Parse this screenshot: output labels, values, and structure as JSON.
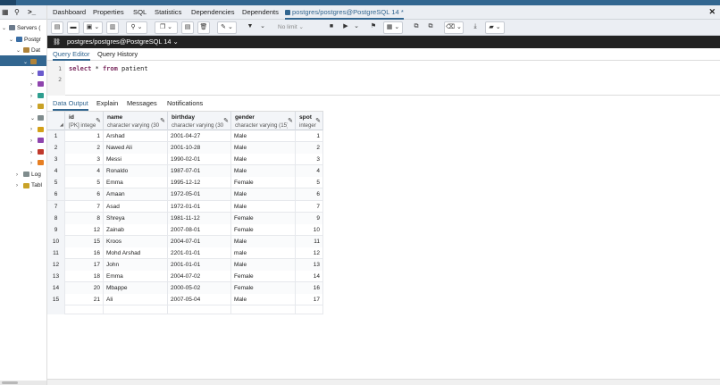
{
  "tree": {
    "header_icons": [
      "grid-icon",
      "search-icon",
      "terminal-icon"
    ],
    "nodes": [
      {
        "label": "Servers (",
        "caret": "v",
        "level": 0
      },
      {
        "label": "Postgr",
        "caret": "v",
        "level": 1
      },
      {
        "label": "Dat",
        "caret": "v",
        "level": 2
      },
      {
        "label": "",
        "caret": "v",
        "level": 3
      },
      {
        "label": "",
        "caret": "v",
        "level": 4
      },
      {
        "label": "",
        "caret": ">",
        "level": 4
      },
      {
        "label": "",
        "caret": ">",
        "level": 4
      },
      {
        "label": "",
        "caret": ">",
        "level": 4
      },
      {
        "label": "",
        "caret": "v",
        "level": 4
      },
      {
        "label": "",
        "caret": ">",
        "level": 4
      },
      {
        "label": "",
        "caret": ">",
        "level": 4
      },
      {
        "label": "",
        "caret": ">",
        "level": 4
      },
      {
        "label": "",
        "caret": ">",
        "level": 4
      },
      {
        "label": "Log",
        "caret": ">",
        "level": 2
      },
      {
        "label": "Tabl",
        "caret": ">",
        "level": 2
      }
    ]
  },
  "tabs": [
    {
      "label": "Dashboard"
    },
    {
      "label": "Properties"
    },
    {
      "label": "SQL"
    },
    {
      "label": "Statistics"
    },
    {
      "label": "Dependencies"
    },
    {
      "label": "Dependents"
    },
    {
      "label": "postgres/postgres@PostgreSQL 14 *",
      "active": true
    }
  ],
  "close_label": "✕",
  "toolbar": {
    "limit_label": "No limit"
  },
  "connection": {
    "label": "postgres/postgres@PostgreSQL 14 ⌄"
  },
  "query_tabs": [
    {
      "label": "Query Editor",
      "active": true
    },
    {
      "label": "Query History"
    }
  ],
  "editor": {
    "lines": [
      {
        "n": "1",
        "keyword1": "select",
        "mid": " * ",
        "keyword2": "from",
        "rest": " patient"
      },
      {
        "n": "2"
      }
    ]
  },
  "result_tabs": [
    {
      "label": "Data Output",
      "active": true
    },
    {
      "label": "Explain"
    },
    {
      "label": "Messages"
    },
    {
      "label": "Notifications"
    }
  ],
  "grid": {
    "columns": [
      {
        "name": "id",
        "type": "[PK] integer"
      },
      {
        "name": "name",
        "type": "character varying (30)"
      },
      {
        "name": "birthday",
        "type": "character varying (30)"
      },
      {
        "name": "gender",
        "type": "character varying (15)"
      },
      {
        "name": "spot",
        "type": "integer"
      }
    ],
    "rows": [
      [
        "1",
        "1",
        "Arshad",
        "2001-04-27",
        "Male",
        "1"
      ],
      [
        "2",
        "2",
        "Nawed Ali",
        "2001-10-28",
        "Male",
        "2"
      ],
      [
        "3",
        "3",
        "Messi",
        "1990-02-01",
        "Male",
        "3"
      ],
      [
        "4",
        "4",
        "Ronaldo",
        "1987-07-01",
        "Male",
        "4"
      ],
      [
        "5",
        "5",
        "Emma",
        "1995-12-12",
        "Female",
        "5"
      ],
      [
        "6",
        "6",
        "Amaan",
        "1972-05-01",
        "Male",
        "6"
      ],
      [
        "7",
        "7",
        "Asad",
        "1972-01-01",
        "Male",
        "7"
      ],
      [
        "8",
        "8",
        "Shreya",
        "1981-11-12",
        "Female",
        "9"
      ],
      [
        "9",
        "12",
        "Zainab",
        "2007-08-01",
        "Female",
        "10"
      ],
      [
        "10",
        "15",
        "Kroos",
        "2004-07-01",
        "Male",
        "11"
      ],
      [
        "11",
        "16",
        "Mohd Arshad",
        "2201-01-01",
        "male",
        "12"
      ],
      [
        "12",
        "17",
        "John",
        "2001-01-01",
        "Male",
        "13"
      ],
      [
        "13",
        "18",
        "Emma",
        "2004-07-02",
        "Female",
        "14"
      ],
      [
        "14",
        "20",
        "Mbappe",
        "2000-05-02",
        "Female",
        "16"
      ],
      [
        "15",
        "21",
        "Ali",
        "2007-05-04",
        "Male",
        "17"
      ]
    ]
  },
  "colors": {
    "accent": "#326690",
    "connbar": "#222222",
    "header_bg": "#ebeef3"
  }
}
